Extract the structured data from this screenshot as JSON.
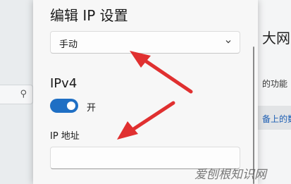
{
  "dialog": {
    "title": "编辑 IP 设置",
    "mode_select": {
      "value": "手动"
    },
    "section_title": "IPv4",
    "toggle": {
      "state_label": "开",
      "on": true
    },
    "ip_address": {
      "label": "IP 地址",
      "value": ""
    }
  },
  "background": {
    "big_text": "大网",
    "text_1": "的功能",
    "text_2": "备上的数"
  },
  "watermark": "爱刨根知识网",
  "colors": {
    "accent": "#1f6fc4",
    "arrow": "#e03030"
  },
  "icons": {
    "search": "search-icon",
    "chevron": "chevron-down-icon"
  }
}
